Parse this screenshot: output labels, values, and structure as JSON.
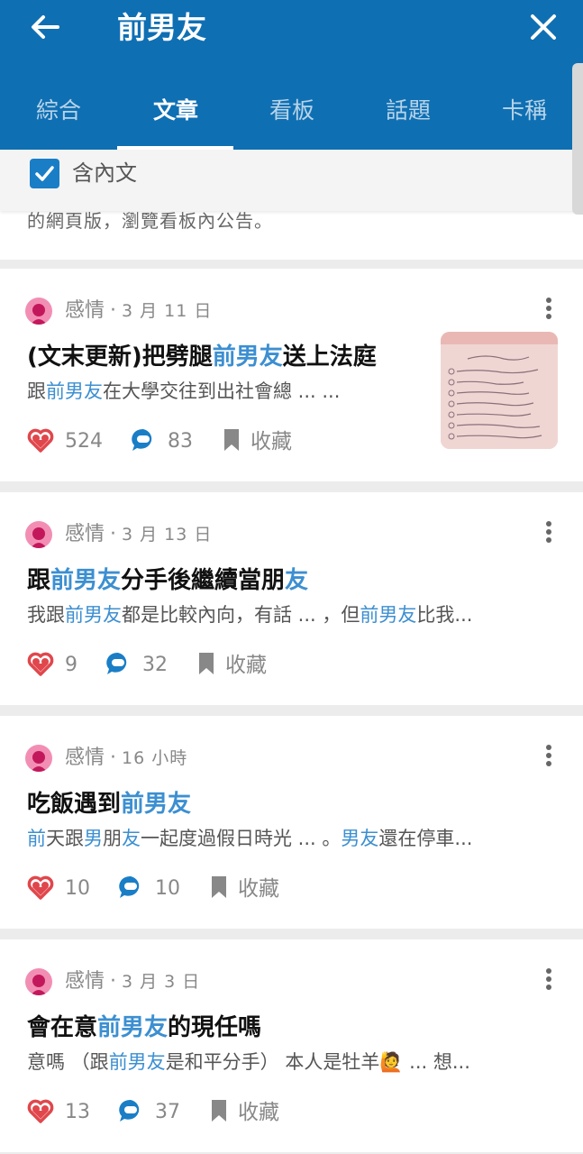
{
  "header": {
    "title": "前男友",
    "tabs": [
      {
        "label": "綜合"
      },
      {
        "label": "文章"
      },
      {
        "label": "看板"
      },
      {
        "label": "話題"
      },
      {
        "label": "卡稱"
      }
    ],
    "active_tab": "文章",
    "background_color": "#0f6fb3"
  },
  "filter": {
    "checkbox_label": "含內文",
    "checked": true
  },
  "notice": {
    "text": "的網頁版，瀏覽看板內公告。"
  },
  "bookmark_label": "收藏",
  "posts": [
    {
      "forum": "感情",
      "time": "3 月 11 日",
      "title_parts": [
        "(文末更新)把劈腿",
        "前男友",
        "送上法庭"
      ],
      "excerpt_parts": [
        "跟",
        "前男友",
        "在大學交往到出社會總 ... ..."
      ],
      "likes": "524",
      "comments": "83",
      "has_thumbnail": true
    },
    {
      "forum": "感情",
      "time": "3 月 13 日",
      "title_parts": [
        "跟",
        "前男友",
        "分手後繼續當朋",
        "友"
      ],
      "excerpt_parts": [
        "我跟",
        "前男友",
        "都是比較內向，有話 ... ，但",
        "前男友",
        "比我..."
      ],
      "likes": "9",
      "comments": "32",
      "has_thumbnail": false
    },
    {
      "forum": "感情",
      "time": "16 小時",
      "title_parts": [
        "吃飯遇到",
        "前男友"
      ],
      "excerpt_parts": [
        "前",
        "天跟",
        "男",
        "朋",
        "友",
        "一起度過假日時光 ... 。",
        "男友",
        "還在停車..."
      ],
      "likes": "10",
      "comments": "10",
      "has_thumbnail": false
    },
    {
      "forum": "感情",
      "time": "3 月 3 日",
      "title_parts": [
        "會在意",
        "前男友",
        "的現任嗎"
      ],
      "excerpt_parts": [
        "意嗎 （跟",
        "前男友",
        "是和平分手） 本人是牡羊🙋 ... 想..."
      ],
      "likes": "13",
      "comments": "37",
      "has_thumbnail": false
    }
  ],
  "colors": {
    "highlight": "#3c8fd1",
    "heart": "#e0474c",
    "comment": "#1a7ec6",
    "avatar": "#f28eb4"
  }
}
